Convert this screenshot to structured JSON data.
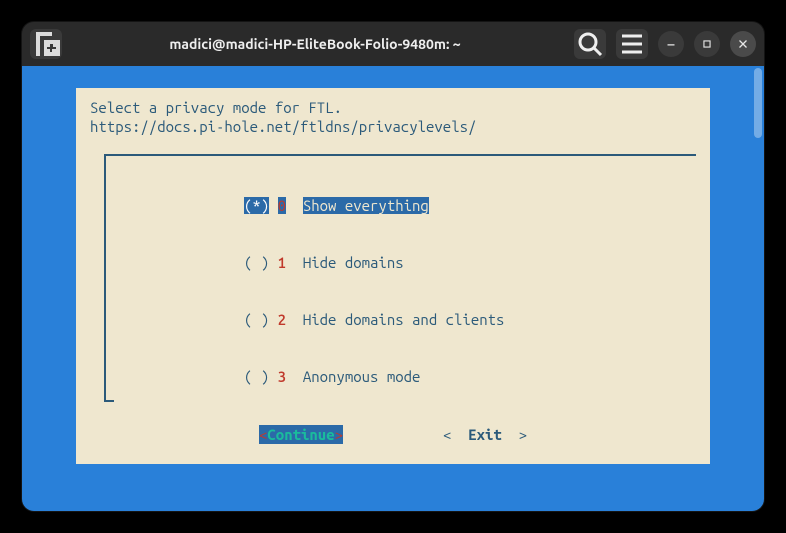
{
  "titlebar": {
    "title": "madici@madici-HP-EliteBook-Folio-9480m: ~"
  },
  "dialog": {
    "prompt_line1": "Select a privacy mode for FTL.",
    "prompt_line2": "https://docs.pi-hole.net/ftldns/privacylevels/",
    "options": [
      {
        "radio": "(*)",
        "num": "0",
        "label": "Show everything",
        "selected": true
      },
      {
        "radio": "( )",
        "num": "1",
        "label": "Hide domains",
        "selected": false
      },
      {
        "radio": "( )",
        "num": "2",
        "label": "Hide domains and clients",
        "selected": false
      },
      {
        "radio": "( )",
        "num": "3",
        "label": "Anonymous mode",
        "selected": false
      }
    ],
    "buttons": {
      "continue": "Continue",
      "exit": "Exit"
    }
  }
}
